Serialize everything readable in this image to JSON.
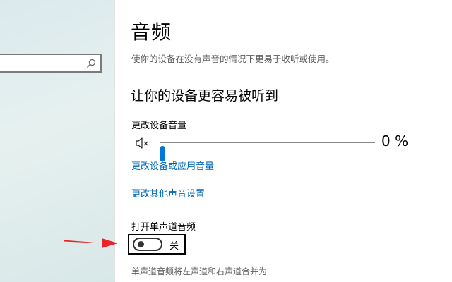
{
  "sidebar": {
    "search_placeholder": ""
  },
  "page": {
    "title": "音频",
    "description": "使你的设备在没有声音的情况下更易于收听或使用。"
  },
  "section": {
    "heading": "让你的设备更容易被听到"
  },
  "volume": {
    "label": "更改设备音量",
    "value_text": "0 %",
    "level_fraction": 0.0
  },
  "links": {
    "app_volume": "更改设备或应用音量",
    "other_sound": "更改其他声音设置"
  },
  "mono_audio": {
    "label": "打开单声道音频",
    "state_text": "关",
    "enabled": false,
    "note": "单声道音频将左声道和右声道合并为一个声道。"
  },
  "colors": {
    "accent": "#0078d7",
    "link": "#0067b8",
    "annotation_arrow": "#e8262a"
  }
}
